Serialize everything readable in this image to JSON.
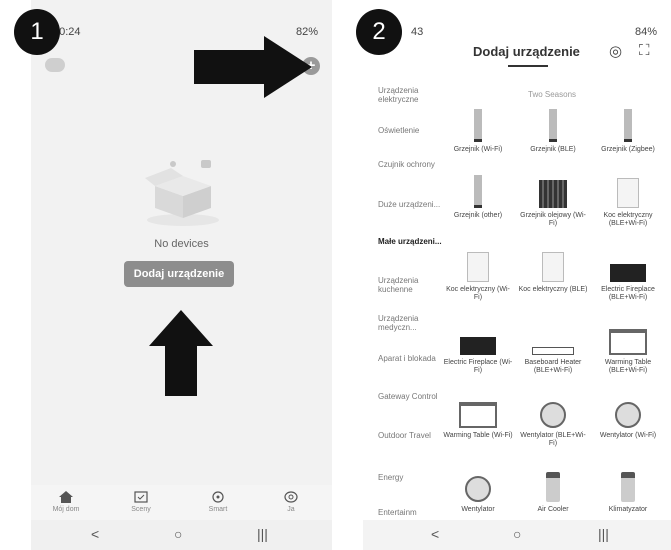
{
  "step1": {
    "number": "1"
  },
  "step2": {
    "number": "2"
  },
  "phone1": {
    "status": {
      "time": "10:24",
      "right": "82%"
    },
    "no_devices": "No devices",
    "add_button": "Dodaj urządzenie",
    "tabs": [
      {
        "label": "Mój dom",
        "icon": "home-icon"
      },
      {
        "label": "Sceny",
        "icon": "scenes-icon"
      },
      {
        "label": "Smart",
        "icon": "smart-icon"
      },
      {
        "label": "Ja",
        "icon": "profile-icon"
      }
    ]
  },
  "phone2": {
    "status": {
      "time": "43",
      "right": "84%"
    },
    "title": "Dodaj urządzenie",
    "section": "Two Seasons",
    "categories": [
      "Urządzenia elektryczne",
      "Oświetlenie",
      "Czujnik ochrony",
      "Duże urządzeni...",
      "Małe urządzeni...",
      "Urządzenia kuchenne",
      "Urządzenia medyczn...",
      "Aparat i blokada",
      "Gateway Control",
      "Outdoor Travel",
      "Energy",
      "Entertainm"
    ],
    "devices": [
      "Grzejnik (Wi-Fi)",
      "Grzejnik (BLE)",
      "Grzejnik (Zigbee)",
      "Grzejnik (other)",
      "Grzejnik olejowy (Wi-Fi)",
      "Koc elektryczny (BLE+Wi-Fi)",
      "Koc elektryczny (Wi-Fi)",
      "Koc elektryczny (BLE)",
      "Electric Fireplace (BLE+Wi-Fi)",
      "Electric Fireplace (Wi-Fi)",
      "Baseboard Heater (BLE+Wi-Fi)",
      "Warming Table (BLE+Wi-Fi)",
      "Warming Table (Wi-Fi)",
      "Wentylator (BLE+Wi-Fi)",
      "Wentylator (Wi-Fi)",
      "Wentylator",
      "Air Cooler",
      "Klimatyzator"
    ]
  },
  "nav": {
    "back": "<",
    "home": "○",
    "recent": "|||"
  }
}
